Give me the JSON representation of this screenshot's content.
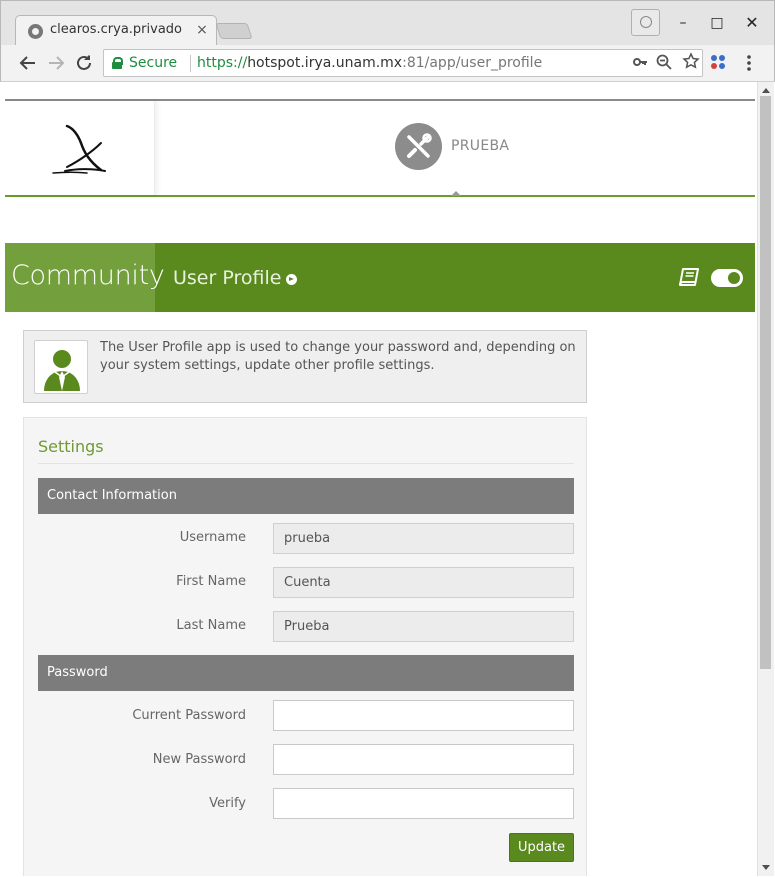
{
  "browser": {
    "tab_title": "clearos.crya.privado",
    "tab_close": "×",
    "secure_label": "Secure",
    "url_scheme": "https://",
    "url_host": "hotspot.irya.unam.mx",
    "url_path": ":81/app/user_profile",
    "window_min": "–",
    "window_max": "□",
    "window_close": "✕"
  },
  "header": {
    "user_name": "PRUEBA"
  },
  "app_bar": {
    "category": "Community",
    "app_name": "User Profile"
  },
  "info": {
    "text": "The User Profile app is used to change your password and, depending on your system settings, update other profile settings."
  },
  "settings": {
    "title": "Settings",
    "contact_section": "Contact Information",
    "username_label": "Username",
    "username_value": "prueba",
    "first_name_label": "First Name",
    "first_name_value": "Cuenta",
    "last_name_label": "Last Name",
    "last_name_value": "Prueba",
    "password_section": "Password",
    "current_password_label": "Current Password",
    "new_password_label": "New Password",
    "verify_label": "Verify",
    "update_label": "Update"
  },
  "colors": {
    "brand_green": "#5a8a1e",
    "brand_green_light": "#73a03c",
    "section_gray": "#7c7c7c"
  }
}
